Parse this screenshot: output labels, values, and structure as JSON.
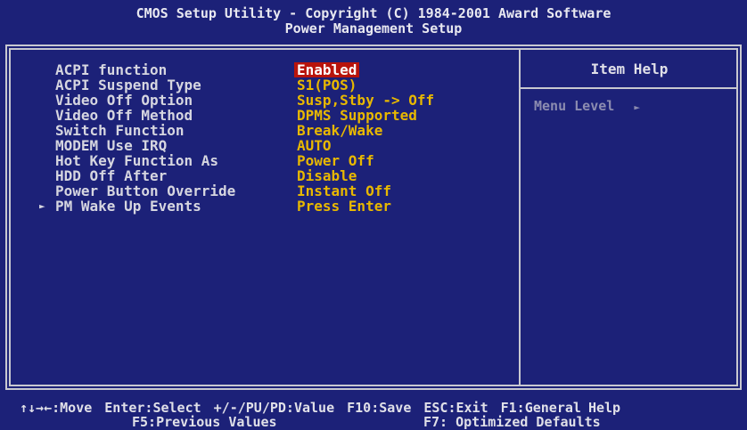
{
  "header": {
    "title": "CMOS Setup Utility - Copyright (C) 1984-2001 Award Software",
    "subtitle": "Power Management Setup"
  },
  "settings": [
    {
      "label": "ACPI function",
      "value": "Enabled",
      "selected": true
    },
    {
      "label": "ACPI Suspend Type",
      "value": "S1(POS)"
    },
    {
      "label": "Video Off Option",
      "value": "Susp,Stby -> Off"
    },
    {
      "label": "Video Off Method",
      "value": "DPMS Supported"
    },
    {
      "label": "Switch Function",
      "value": "Break/Wake"
    },
    {
      "label": "MODEM Use IRQ",
      "value": "AUTO"
    },
    {
      "label": "Hot Key Function As",
      "value": "Power Off"
    },
    {
      "label": "HDD Off After",
      "value": "Disable"
    },
    {
      "label": "Power Button Override",
      "value": "Instant Off"
    },
    {
      "label": "PM Wake Up Events",
      "value": "Press Enter",
      "submenu": true
    }
  ],
  "help": {
    "title": "Item Help",
    "menu_level_label": "Menu Level",
    "menu_level_arrow": "►"
  },
  "footer": {
    "move": "↑↓→←:Move",
    "select": "Enter:Select",
    "value": "+/-/PU/PD:Value",
    "save": "F10:Save",
    "exit": "ESC:Exit",
    "help": "F1:General Help",
    "previous": "F5:Previous Values",
    "optimized": "F7: Optimized Defaults"
  },
  "colors": {
    "background": "#1c2178",
    "value_text": "#e8b800",
    "highlight": "#b8140c"
  }
}
